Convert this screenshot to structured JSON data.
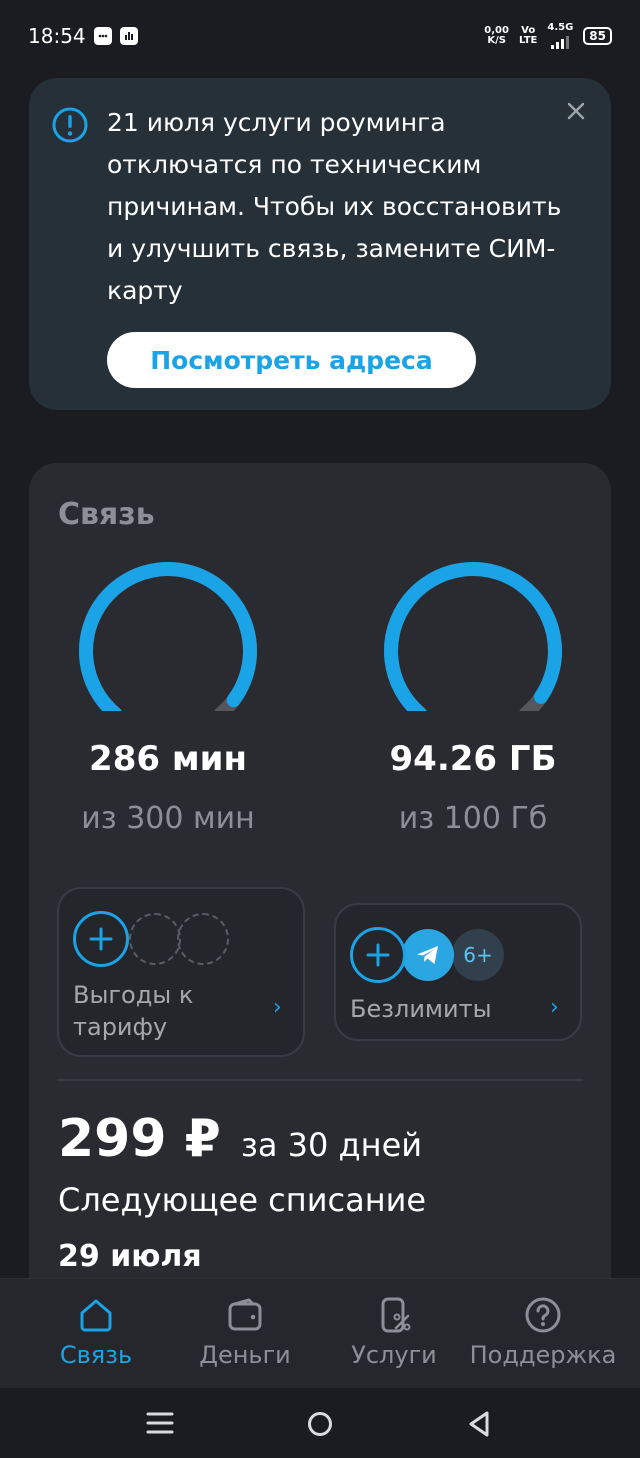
{
  "status_bar": {
    "time": "18:54",
    "net_speed_value": "0,00",
    "net_speed_unit": "K/S",
    "volte_top": "Vo",
    "volte_bottom": "LTE",
    "network_type": "4.5G",
    "battery": "85"
  },
  "notice": {
    "text": "21 июля услуги роуминга отключатся по техническим причинам. Чтобы их восстановить и улучшить связь, замените СИМ-карту",
    "button_label": "Посмотреть адреса",
    "icon": "info-circle-icon",
    "close_icon": "close-icon"
  },
  "connection": {
    "title": "Связь",
    "minutes": {
      "value": "286 мин",
      "total": "из 300 мин",
      "remaining_fraction": 0.953
    },
    "data": {
      "value": "94.26 ГБ",
      "total": "из 100 Гб",
      "remaining_fraction": 0.943
    },
    "benefits_tile": {
      "label": "Выгоды к тарифу"
    },
    "unlimited_tile": {
      "label": "Безлимиты",
      "more_count": "6+"
    },
    "price": {
      "amount": "299 ₽",
      "period": "за 30 дней"
    },
    "next_charge": {
      "label": "Следующее списание",
      "date": "29 июля"
    }
  },
  "bottom_nav": {
    "items": [
      {
        "label": "Связь",
        "icon": "home-icon",
        "active": true
      },
      {
        "label": "Деньги",
        "icon": "wallet-icon",
        "active": false
      },
      {
        "label": "Услуги",
        "icon": "services-percent-icon",
        "active": false
      },
      {
        "label": "Поддержка",
        "icon": "help-circle-icon",
        "active": false
      }
    ]
  },
  "colors": {
    "accent": "#1aa3e6",
    "background": "#1b1c21",
    "card": "#2a2b31",
    "notice": "#253038",
    "muted_text": "#8e8f96"
  }
}
